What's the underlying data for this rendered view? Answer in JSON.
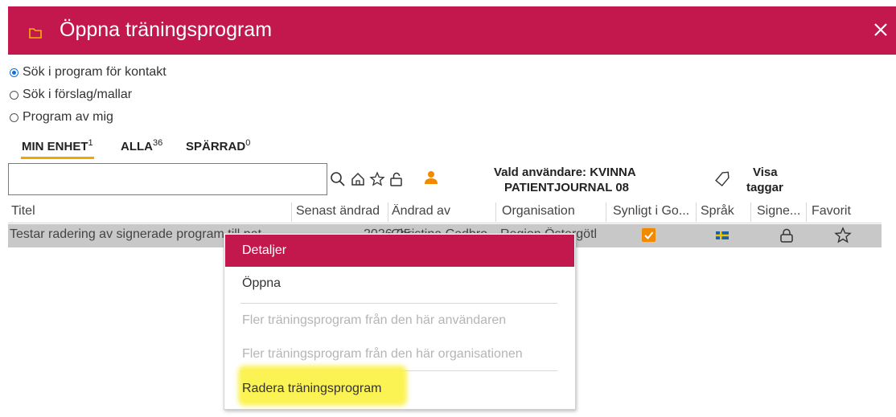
{
  "dialog": {
    "title": "Öppna träningsprogram",
    "folder_icon": "folder-icon",
    "close_icon": "close-icon",
    "accent_color": "#c2184e"
  },
  "search_options": [
    {
      "label": "Sök i program för kontakt",
      "selected": true
    },
    {
      "label": "Sök i förslag/mallar",
      "selected": false
    },
    {
      "label": "Program av mig",
      "selected": false
    }
  ],
  "tabs": [
    {
      "label": "MIN ENHET",
      "count": "1",
      "active": true
    },
    {
      "label": "ALLA",
      "count": "36",
      "active": false
    },
    {
      "label": "SPÄRRAD",
      "count": "0",
      "active": false
    }
  ],
  "search": {
    "value": "",
    "icons": [
      "search-icon",
      "home-icon",
      "star-icon",
      "unlock-icon",
      "person-icon"
    ]
  },
  "selected_user": {
    "line1": "Vald användare: KVINNA",
    "line2": "PATIENTJOURNAL 08"
  },
  "tags": {
    "icon": "tag-icon",
    "line1": "Visa",
    "line2": "taggar"
  },
  "table": {
    "columns": [
      "Titel",
      "Senast ändrad",
      "Ändrad av",
      "Organisation",
      "Synligt i Go...",
      "Språk",
      "Signe...",
      "Favorit"
    ],
    "rows": [
      {
        "title": "Testar radering av signerade program till pat",
        "changed": "2026-05-06",
        "changed_by": "Christina Cedbro",
        "organisation": "Region Östergötl",
        "visible": true,
        "language": "sv",
        "signed_icon": "lock-icon",
        "favorite_icon": "star-outline-icon"
      }
    ]
  },
  "context_menu": {
    "items": [
      {
        "label": "Detaljer",
        "selected": true,
        "disabled": false
      },
      {
        "label": "Öppna",
        "selected": false,
        "disabled": false
      },
      {
        "label": "Fler träningsprogram från den här användaren",
        "selected": false,
        "disabled": true
      },
      {
        "label": "Fler träningsprogram från den här organisationen",
        "selected": false,
        "disabled": true
      },
      {
        "label": "Radera träningsprogram",
        "selected": false,
        "disabled": false,
        "highlighted": true
      }
    ]
  }
}
